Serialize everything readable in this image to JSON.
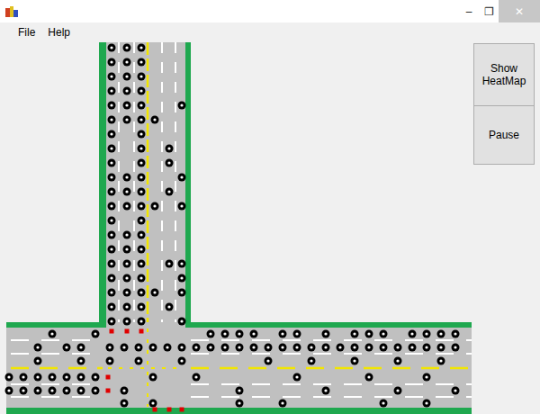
{
  "window": {
    "controls": [
      "–",
      "❐",
      "✕"
    ]
  },
  "menu": [
    {
      "label": "File"
    },
    {
      "label": "Help"
    }
  ],
  "buttons": [
    {
      "label": "Show HeatMap"
    },
    {
      "label": "Pause"
    }
  ],
  "simulation": {
    "vertical_road": {
      "lanes": [
        {
          "direction": "southbound",
          "cars": [
            0,
            1,
            2,
            3,
            4,
            5,
            6,
            7,
            8,
            9,
            10,
            11,
            12,
            13,
            14,
            15,
            16,
            17,
            18,
            19
          ]
        },
        {
          "direction": "southbound",
          "cars": [
            0,
            1,
            2,
            3,
            4,
            5,
            9,
            10,
            11,
            13,
            14,
            15,
            16,
            17,
            18,
            19
          ]
        },
        {
          "direction": "southbound",
          "cars": [
            0,
            1,
            2,
            3,
            4,
            5,
            6,
            7,
            8,
            9,
            10,
            11,
            12,
            13,
            14,
            15,
            16,
            17,
            18,
            19
          ]
        },
        {
          "direction": "northbound",
          "cars": [
            5,
            11,
            17
          ]
        },
        {
          "direction": "northbound",
          "cars": [
            7,
            8,
            10,
            15,
            18
          ]
        },
        {
          "direction": "northbound",
          "cars": [
            4,
            9,
            11,
            15,
            16,
            17,
            19
          ]
        }
      ]
    },
    "horizontal_road": {
      "lanes": [
        {
          "direction": "westbound",
          "cars": [
            3,
            6,
            14,
            15,
            16,
            17,
            19,
            20,
            22,
            24,
            25,
            26,
            28,
            29,
            30,
            31
          ]
        },
        {
          "direction": "westbound",
          "cars": [
            2,
            4,
            5,
            7,
            8,
            9,
            10,
            11,
            12,
            13,
            14,
            15,
            16,
            17,
            18,
            19,
            20,
            21,
            22,
            23,
            24,
            25,
            26,
            27,
            28,
            29,
            30,
            31
          ]
        },
        {
          "direction": "westbound",
          "cars": [
            2,
            5,
            7,
            9,
            12,
            18,
            21,
            24,
            27,
            30
          ]
        },
        {
          "direction": "eastbound",
          "cars": [
            0,
            1,
            2,
            3,
            4,
            5,
            6,
            10,
            13,
            20,
            25,
            29
          ]
        },
        {
          "direction": "eastbound",
          "cars": [
            0,
            1,
            2,
            3,
            4,
            5,
            6,
            8,
            16,
            22,
            27,
            31
          ]
        },
        {
          "direction": "eastbound",
          "cars": [
            8,
            10,
            16,
            19,
            26,
            29
          ]
        }
      ]
    },
    "signals": [
      {
        "color": "#e00000"
      },
      {
        "color": "#e00000"
      },
      {
        "color": "#e00000"
      },
      {
        "color": "#e00000"
      },
      {
        "color": "#e00000"
      },
      {
        "color": "#e00000"
      },
      {
        "color": "#e00000"
      },
      {
        "color": "#e00000"
      }
    ]
  }
}
